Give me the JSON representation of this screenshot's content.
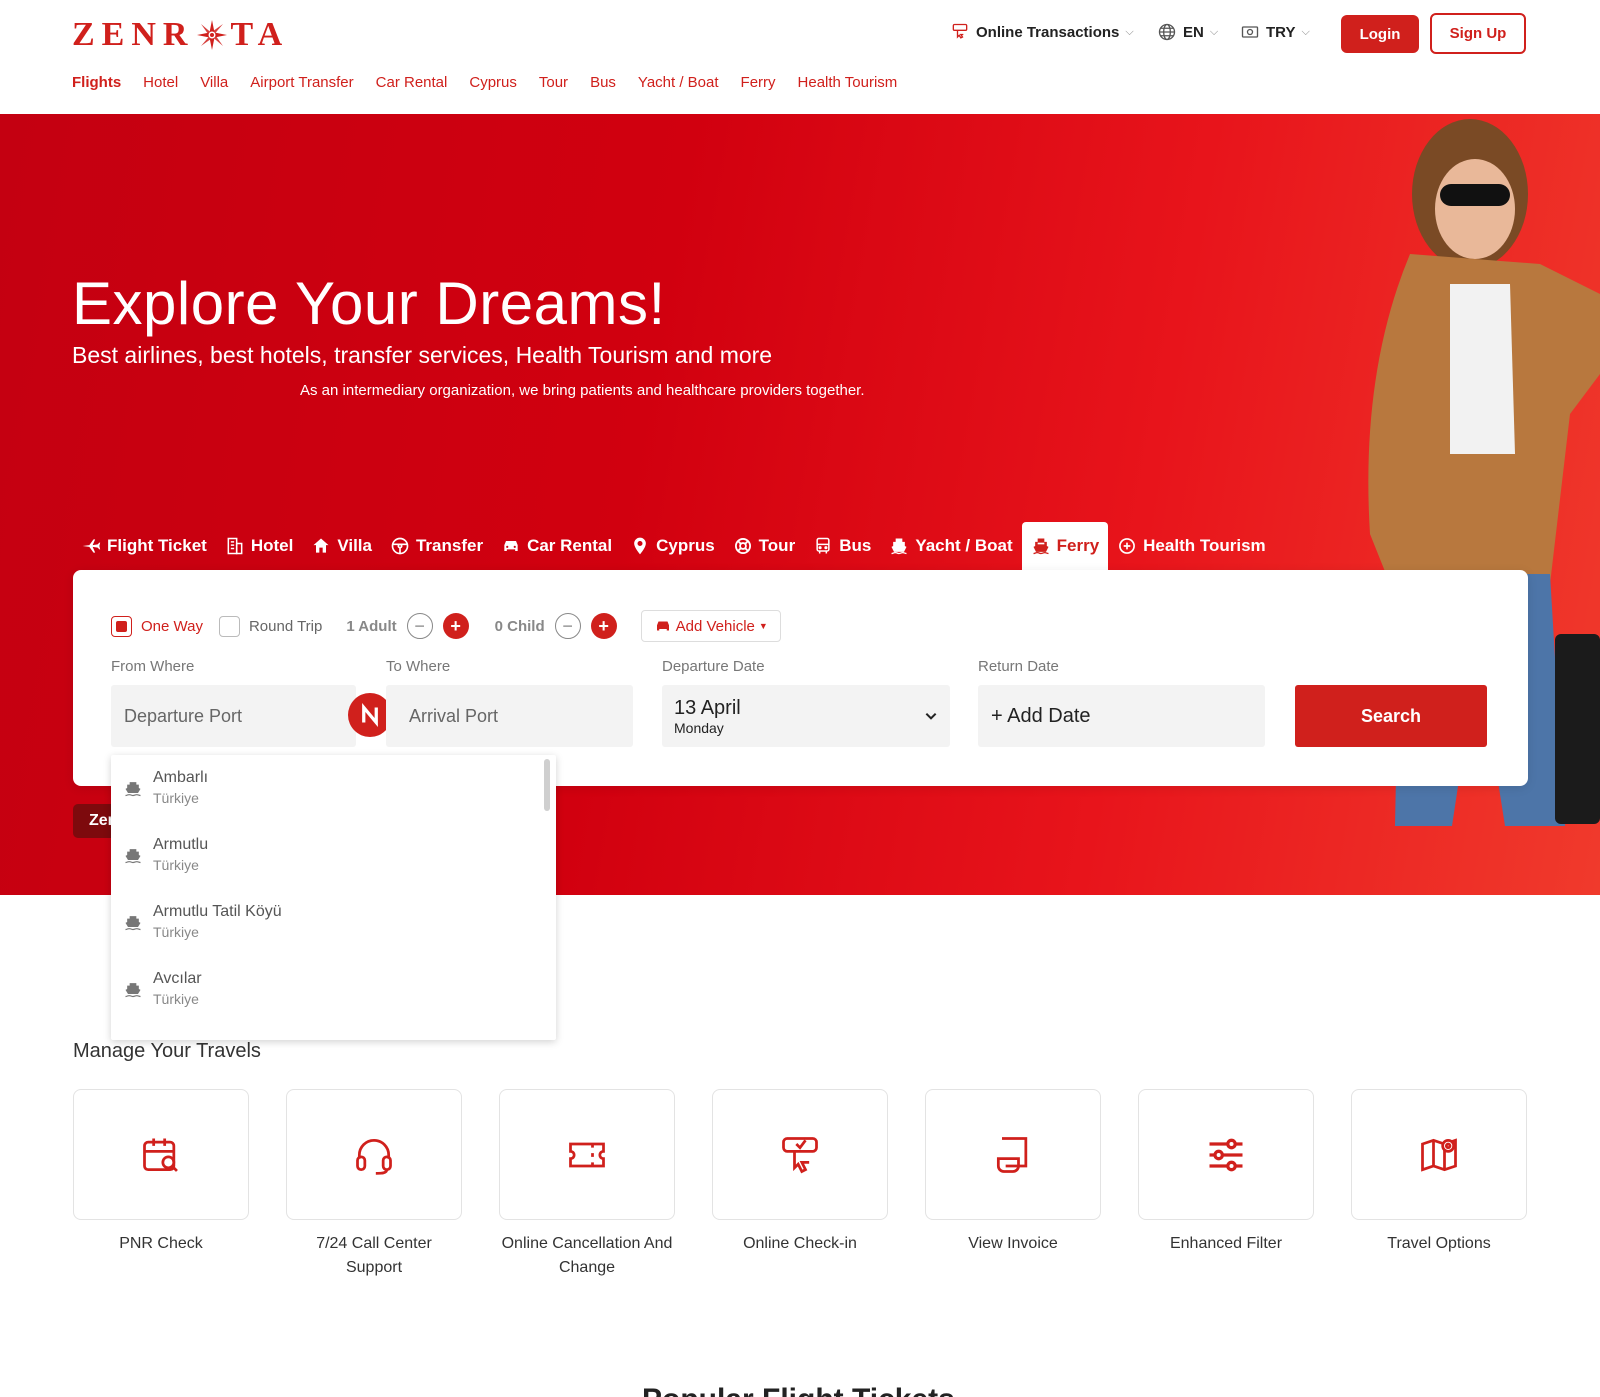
{
  "brand": {
    "logo_left": "ZENR",
    "logo_right": "TA"
  },
  "topnav": [
    "Flights",
    "Hotel",
    "Villa",
    "Airport Transfer",
    "Car Rental",
    "Cyprus",
    "Tour",
    "Bus",
    "Yacht / Boat",
    "Ferry",
    "Health Tourism"
  ],
  "header": {
    "online_transactions": "Online Transactions",
    "language": "EN",
    "currency": "TRY",
    "login": "Login",
    "signup": "Sign Up"
  },
  "hero": {
    "title": "Explore Your Dreams!",
    "subtitle": "Best airlines, best hotels, transfer services, Health Tourism and more",
    "note": "As an intermediary organization, we bring patients and healthcare providers together."
  },
  "tabs": [
    {
      "label": "Flight Ticket",
      "icon": "plane-icon"
    },
    {
      "label": "Hotel",
      "icon": "building-icon"
    },
    {
      "label": "Villa",
      "icon": "home-icon"
    },
    {
      "label": "Transfer",
      "icon": "steering-wheel-icon"
    },
    {
      "label": "Car Rental",
      "icon": "car-icon"
    },
    {
      "label": "Cyprus",
      "icon": "map-pin-icon"
    },
    {
      "label": "Tour",
      "icon": "lifebuoy-icon"
    },
    {
      "label": "Bus",
      "icon": "bus-icon"
    },
    {
      "label": "Yacht / Boat",
      "icon": "ship-icon"
    },
    {
      "label": "Ferry",
      "icon": "ferry-icon",
      "active": true
    },
    {
      "label": "Health Tourism",
      "icon": "plus-circle-icon"
    }
  ],
  "search": {
    "one_way": "One Way",
    "round_trip": "Round Trip",
    "adults": "1 Adult",
    "children": "0 Child",
    "add_vehicle": "Add Vehicle",
    "from_label": "From Where",
    "to_label": "To Where",
    "departure_label": "Departure Date",
    "return_label": "Return Date",
    "from_placeholder": "Departure Port",
    "to_placeholder": "Arrival Port",
    "departure_date": "13 April",
    "departure_day": "Monday",
    "return_placeholder": "+ Add Date",
    "search_button": "Search"
  },
  "chip": "Zen",
  "dropdown": [
    {
      "name": "Ambarlı",
      "country": "Türkiye"
    },
    {
      "name": "Armutlu",
      "country": "Türkiye"
    },
    {
      "name": "Armutlu Tatil Köyü",
      "country": "Türkiye"
    },
    {
      "name": "Avcılar",
      "country": "Türkiye"
    }
  ],
  "manage": {
    "title": "Manage Your Travels",
    "cards": [
      {
        "label": "PNR Check",
        "icon": "calendar-search-icon"
      },
      {
        "label": "7/24 Call Center Support",
        "icon": "headset-icon"
      },
      {
        "label": "Online Cancellation And Change",
        "icon": "ticket-icon"
      },
      {
        "label": "Online Check-in",
        "icon": "hand-check-icon"
      },
      {
        "label": "View Invoice",
        "icon": "invoice-icon"
      },
      {
        "label": "Enhanced Filter",
        "icon": "sliders-icon"
      },
      {
        "label": "Travel Options",
        "icon": "map-options-icon"
      }
    ]
  },
  "popular_title": "Popular Flight Tickets",
  "colors": {
    "accent": "#d0201c"
  }
}
